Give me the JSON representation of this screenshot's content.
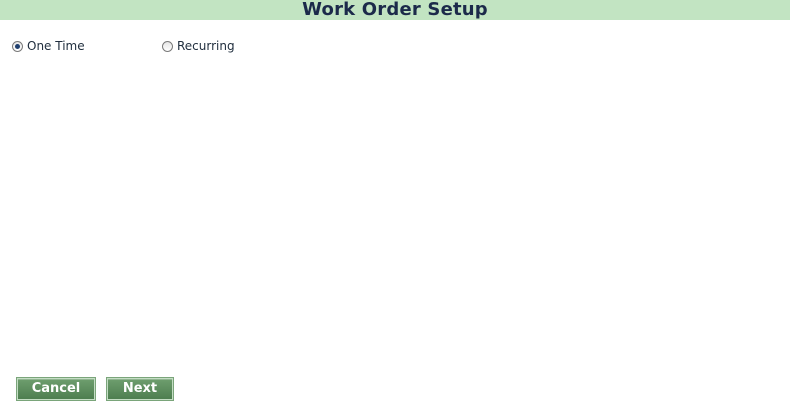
{
  "header": {
    "title": "Work Order Setup"
  },
  "schedule_type": {
    "options": [
      {
        "label": "One Time",
        "checked": true
      },
      {
        "label": "Recurring",
        "checked": false
      }
    ]
  },
  "footer": {
    "cancel_label": "Cancel",
    "next_label": "Next"
  },
  "colors": {
    "title_bar_bg": "#c2e4c2",
    "title_text": "#1c2a4a",
    "button_bg": "#5a8a5c",
    "button_text": "#ffffff"
  }
}
